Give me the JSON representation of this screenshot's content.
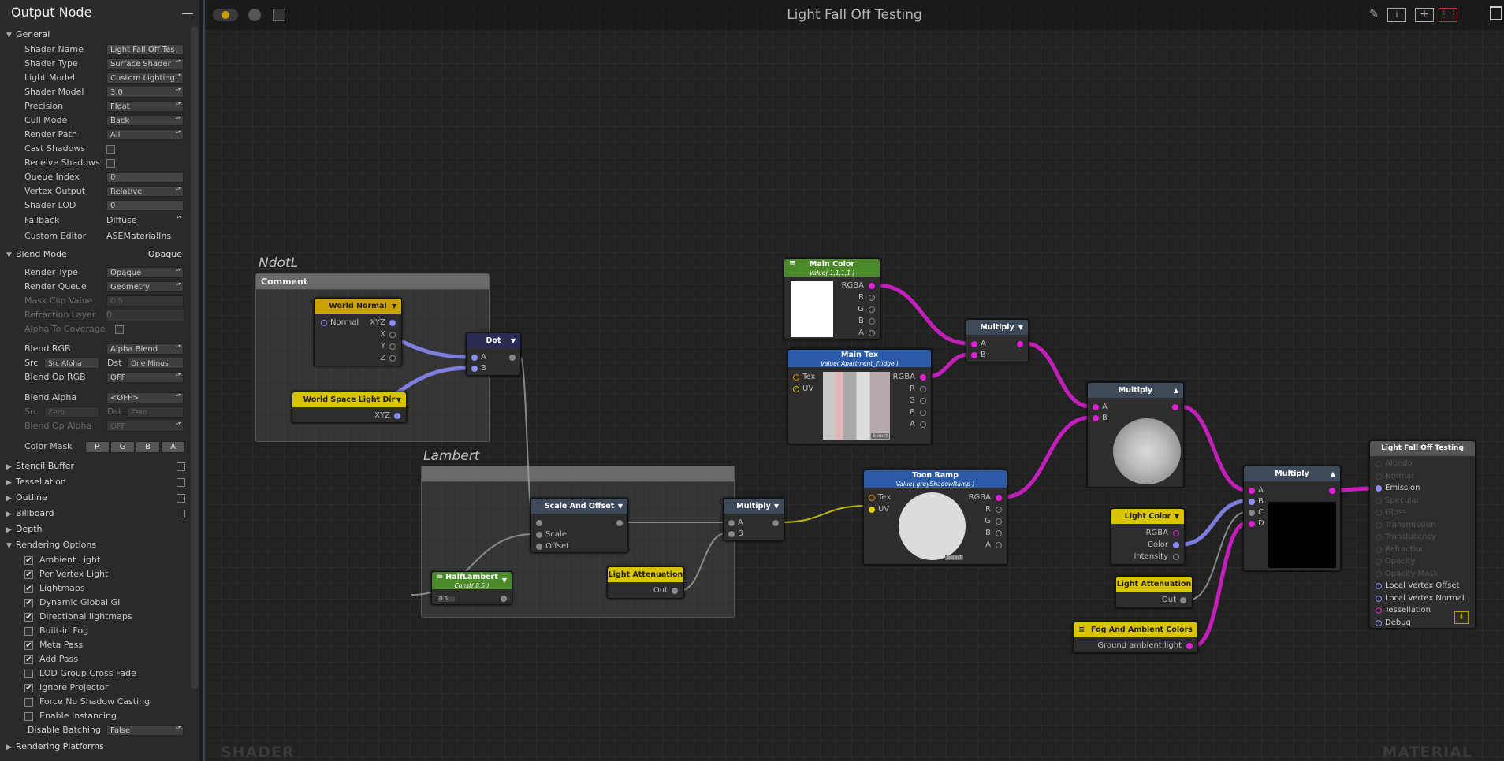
{
  "panel": {
    "title": "Output Node",
    "general": {
      "label": "General",
      "shader_name": {
        "label": "Shader Name",
        "value": "Light Fall Off Tes"
      },
      "shader_type": {
        "label": "Shader Type",
        "value": "Surface Shader"
      },
      "light_model": {
        "label": "Light Model",
        "value": "Custom Lighting"
      },
      "shader_model": {
        "label": "Shader Model",
        "value": "3.0"
      },
      "precision": {
        "label": "Precision",
        "value": "Float"
      },
      "cull_mode": {
        "label": "Cull Mode",
        "value": "Back"
      },
      "render_path": {
        "label": "Render Path",
        "value": "All"
      },
      "cast_shadows": {
        "label": "Cast Shadows"
      },
      "receive_shadows": {
        "label": "Receive Shadows"
      },
      "queue_index": {
        "label": "Queue Index",
        "value": "0"
      },
      "vertex_output": {
        "label": "Vertex Output",
        "value": "Relative"
      },
      "shader_lod": {
        "label": "Shader LOD",
        "value": "0"
      },
      "fallback": {
        "label": "Fallback",
        "value": "Diffuse"
      },
      "custom_editor": {
        "label": "Custom Editor",
        "value": "ASEMaterialIns"
      }
    },
    "blend": {
      "label": "Blend Mode",
      "value": "Opaque",
      "render_type": {
        "label": "Render Type",
        "value": "Opaque"
      },
      "render_queue": {
        "label": "Render Queue",
        "value": "Geometry"
      },
      "mask_clip": {
        "label": "Mask Clip Value",
        "value": "0.5"
      },
      "refraction_layer": {
        "label": "Refraction Layer",
        "value": "0"
      },
      "alpha_coverage": {
        "label": "Alpha To Coverage"
      },
      "blend_rgb": {
        "label": "Blend RGB",
        "value": "Alpha Blend"
      },
      "src_label": "Src",
      "src_value": "Src Alpha",
      "dst_label": "Dst",
      "dst_value": "One Minus",
      "blend_op_rgb": {
        "label": "Blend Op RGB",
        "value": "OFF"
      },
      "blend_alpha": {
        "label": "Blend Alpha",
        "value": "<OFF>"
      },
      "src2_label": "Src",
      "src2_value": "Zero",
      "dst2_label": "Dst",
      "dst2_value": "Zero",
      "blend_op_alpha": {
        "label": "Blend Op Alpha",
        "value": "OFF"
      },
      "color_mask": {
        "label": "Color Mask",
        "channels": [
          "R",
          "G",
          "B",
          "A"
        ]
      }
    },
    "sections": [
      "Stencil Buffer",
      "Tessellation",
      "Outline",
      "Billboard"
    ],
    "depth": "Depth",
    "rendering_options": {
      "label": "Rendering Options",
      "items": [
        {
          "label": "Ambient Light",
          "checked": "✔"
        },
        {
          "label": "Per Vertex Light",
          "checked": "✔"
        },
        {
          "label": "Lightmaps",
          "checked": "✔"
        },
        {
          "label": "Dynamic Global GI",
          "checked": "✔"
        },
        {
          "label": "Directional lightmaps",
          "checked": "✔"
        },
        {
          "label": "Built-in Fog",
          "checked": ""
        },
        {
          "label": "Meta Pass",
          "checked": "✔"
        },
        {
          "label": "Add Pass",
          "checked": "✔"
        },
        {
          "label": "LOD Group Cross Fade",
          "checked": ""
        },
        {
          "label": "Ignore Projector",
          "checked": "✔"
        },
        {
          "label": "Force No Shadow Casting",
          "checked": ""
        },
        {
          "label": "Enable Instancing",
          "checked": ""
        }
      ],
      "disable_batching": {
        "label": "Disable Batching",
        "value": "False"
      }
    },
    "rendering_platforms": "Rendering Platforms"
  },
  "canvas": {
    "title": "Light Fall Off Testing",
    "watermark_left": "SHADER",
    "watermark_right": "MATERIAL",
    "toolbar_icons": [
      "live-icon",
      "cleanup-icon",
      "share-icon",
      "info-icon",
      "maximize-icon",
      "grid-icon"
    ],
    "groups": {
      "ndotl": {
        "label": "NdotL",
        "header": "Comment"
      },
      "lambert": {
        "label": "Lambert",
        "header": ""
      }
    },
    "nodes": {
      "world_normal": {
        "title": "World Normal",
        "in": "Normal",
        "out": "XYZ",
        "x": "X",
        "y": "Y",
        "z": "Z"
      },
      "world_light_dir": {
        "title": "World Space Light Dir",
        "out": "XYZ"
      },
      "dot": {
        "title": "Dot",
        "a": "A",
        "b": "B"
      },
      "scale_offset": {
        "title": "Scale And Offset",
        "scale": "Scale",
        "offset": "Offset"
      },
      "multiply_lambert": {
        "title": "Multiply",
        "a": "A",
        "b": "B"
      },
      "half_lambert": {
        "title": "HalfLambert",
        "sub": "Const( 0.5 )",
        "value": "0.5"
      },
      "light_att1": {
        "title": "Light Attenuation",
        "out": "Out"
      },
      "main_color": {
        "title": "Main Color",
        "sub": "Value( 1,1,1,1 )",
        "rgba": "RGBA",
        "r": "R",
        "g": "G",
        "b": "B",
        "a": "A"
      },
      "main_tex": {
        "title": "Main Tex",
        "sub": "Value( Apartment_Fridge )",
        "tex": "Tex",
        "uv": "UV",
        "rgba": "RGBA",
        "r": "R",
        "g": "G",
        "b": "B",
        "a": "A",
        "select": "Select"
      },
      "multiply1": {
        "title": "Multiply",
        "a": "A",
        "b": "B"
      },
      "multiply2": {
        "title": "Multiply",
        "a": "A",
        "b": "B"
      },
      "toon_ramp": {
        "title": "Toon Ramp",
        "sub": "Value( greyShadowRamp )",
        "tex": "Tex",
        "uv": "UV",
        "rgba": "RGBA",
        "r": "R",
        "g": "G",
        "b": "B",
        "a": "A",
        "select": "Select"
      },
      "light_color": {
        "title": "Light Color",
        "rgba": "RGBA",
        "color": "Color",
        "intensity": "Intensity"
      },
      "light_att2": {
        "title": "Light Attenuation",
        "out": "Out"
      },
      "fog": {
        "title": "Fog And Ambient Colors",
        "out": "Ground ambient light"
      },
      "multiply3": {
        "title": "Multiply",
        "a": "A",
        "b": "B",
        "c": "C",
        "d": "D"
      },
      "output": {
        "title": "Light Fall Off Testing",
        "ports": [
          "Albedo",
          "Normal",
          "Emission",
          "Specular",
          "Gloss",
          "Transmission",
          "Translucency",
          "Refraction",
          "Opacity",
          "Opacity Mask",
          "Local Vertex Offset",
          "Local Vertex Normal",
          "Tessellation",
          "Debug"
        ]
      }
    }
  },
  "colors": {
    "wire_pink": "#e01fd6",
    "wire_purple": "#8c8cff",
    "wire_yellow": "#e0d000",
    "wire_gray": "#9a9a9a"
  }
}
